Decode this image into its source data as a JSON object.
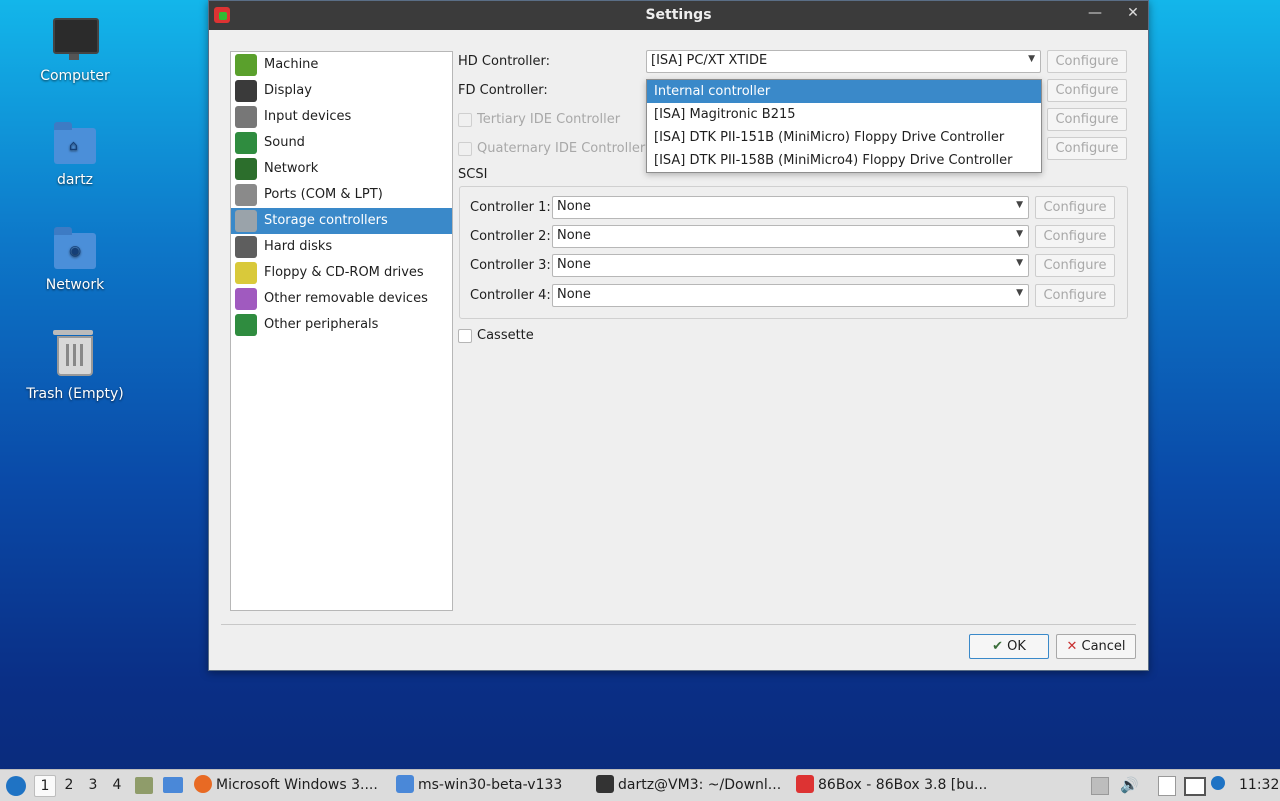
{
  "desktop": {
    "icons": [
      {
        "label": "Computer"
      },
      {
        "label": "dartz"
      },
      {
        "label": "Network"
      },
      {
        "label": "Trash (Empty)"
      }
    ]
  },
  "dialog": {
    "title": "Settings",
    "minimize": "—",
    "close": "✕",
    "sidebar": [
      {
        "label": "Machine",
        "color": "#5aa02c"
      },
      {
        "label": "Display",
        "color": "#3a3a3a"
      },
      {
        "label": "Input devices",
        "color": "#777777"
      },
      {
        "label": "Sound",
        "color": "#2f8c3f"
      },
      {
        "label": "Network",
        "color": "#2c6e2c"
      },
      {
        "label": "Ports (COM & LPT)",
        "color": "#8a8a8a"
      },
      {
        "label": "Storage controllers",
        "color": "#9aa3aa"
      },
      {
        "label": "Hard disks",
        "color": "#5e5e5e"
      },
      {
        "label": "Floppy & CD-ROM drives",
        "color": "#d9c93a"
      },
      {
        "label": "Other removable devices",
        "color": "#a05abf"
      },
      {
        "label": "Other peripherals",
        "color": "#2f8c3f"
      }
    ],
    "selected_sidebar": "Storage controllers",
    "hd_controller": {
      "label": "HD Controller:",
      "value": "[ISA] PC/XT XTIDE",
      "configure": "Configure"
    },
    "fd_controller": {
      "label": "FD Controller:",
      "configure": "Configure"
    },
    "tertiary_ide": {
      "label": "Tertiary IDE Controller",
      "configure": "Configure"
    },
    "quaternary_ide": {
      "label": "Quaternary IDE Controller",
      "configure": "Configure"
    },
    "fd_dropdown": {
      "options": [
        "Internal controller",
        "[ISA] Magitronic B215",
        "[ISA] DTK PII-151B (MiniMicro) Floppy Drive Controller",
        "[ISA] DTK PII-158B (MiniMicro4) Floppy Drive Controller"
      ],
      "selected": "Internal controller"
    },
    "scsi": {
      "title": "SCSI",
      "controllers": [
        {
          "label": "Controller 1:",
          "value": "None",
          "configure": "Configure"
        },
        {
          "label": "Controller 2:",
          "value": "None",
          "configure": "Configure"
        },
        {
          "label": "Controller 3:",
          "value": "None",
          "configure": "Configure"
        },
        {
          "label": "Controller 4:",
          "value": "None",
          "configure": "Configure"
        }
      ]
    },
    "cassette": {
      "label": "Cassette"
    },
    "ok": "OK",
    "cancel": "Cancel"
  },
  "taskbar": {
    "workspaces": [
      "1",
      "2",
      "3",
      "4"
    ],
    "tasks": [
      {
        "label": "Microsoft Windows 3...."
      },
      {
        "label": "ms-win30-beta-v133"
      },
      {
        "label": "dartz@VM3: ~/Downl..."
      },
      {
        "label": "86Box - 86Box 3.8 [bu..."
      }
    ],
    "clock": "11:32"
  }
}
